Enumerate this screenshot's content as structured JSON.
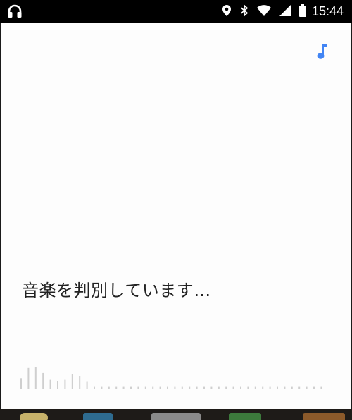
{
  "status_bar": {
    "time": "15:44",
    "left_icons": [
      "headphones-icon"
    ],
    "right_icons": [
      "location-icon",
      "bluetooth-icon",
      "wifi-icon",
      "cell-signal-icon",
      "battery-icon"
    ]
  },
  "card": {
    "mode_icon": "music-note-icon",
    "status_text": "音楽を判別しています…",
    "accent_color": "#4285f4"
  },
  "waveform": {
    "levels": [
      0.35,
      0.72,
      0.74,
      0.55,
      0.32,
      0.28,
      0.32,
      0.5,
      0.45,
      0.25,
      0.08,
      0.08,
      0.08,
      0.08,
      0.08,
      0.08,
      0.08,
      0.08,
      0.08,
      0.08,
      0.08,
      0.08,
      0.08,
      0.08,
      0.08,
      0.08,
      0.08,
      0.08,
      0.08,
      0.08,
      0.08,
      0.08,
      0.08,
      0.08,
      0.08,
      0.08,
      0.08,
      0.08,
      0.08,
      0.08,
      0.08,
      0.08
    ],
    "color": "#cfcfcf"
  }
}
